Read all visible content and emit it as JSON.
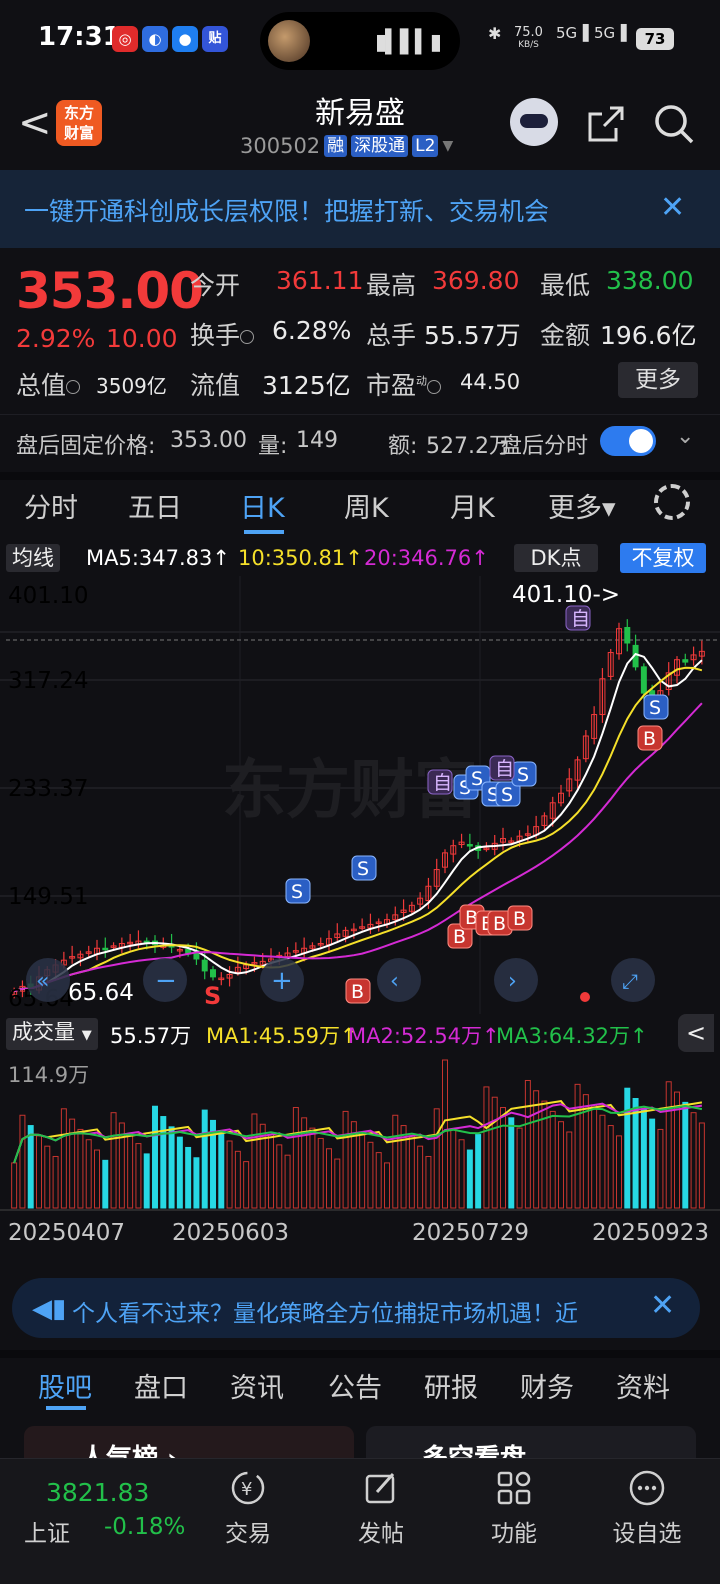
{
  "status_bar": {
    "time": "17:31",
    "net_speed": "75.0",
    "net_unit": "KB/S",
    "signal_1": "5G",
    "signal_2": "5G",
    "battery": "73"
  },
  "header": {
    "back": "<",
    "logo_line1": "东方",
    "logo_line2": "财富",
    "title": "新易盛",
    "code": "300502",
    "tags": [
      "融",
      "深股通",
      "L2"
    ]
  },
  "banner": {
    "text": "一键开通科创成长层权限！把握打新、交易机会",
    "close": "✕"
  },
  "quote": {
    "price": "353.00",
    "change_pct": "2.92%",
    "change": "10.00",
    "open_label": "今开",
    "open": "361.11",
    "high_label": "最高",
    "high": "369.80",
    "low_label": "最低",
    "low": "338.00",
    "turnover_label": "换手",
    "turnover": "6.28%",
    "volume_label": "总手",
    "volume": "55.57万",
    "amount_label": "金额",
    "amount": "196.6亿",
    "mktcap_label": "总值",
    "mktcap": "3509亿",
    "float_label": "流值",
    "float": "3125亿",
    "pe_label": "市盈",
    "pe_sup": "动",
    "pe": "44.50",
    "more": "更多"
  },
  "after_hours": {
    "price_label": "盘后固定价格:",
    "price": "353.00",
    "qty_label": "量:",
    "qty": "149",
    "amt_label": "额:",
    "amt": "527.2万",
    "ts_label": "盘后分时"
  },
  "period_tabs": [
    "分时",
    "五日",
    "日K",
    "周K",
    "月K",
    "更多▾"
  ],
  "active_period": "日K",
  "ma_legend": {
    "btn": "均线",
    "ma5": "MA5:347.83↑",
    "ma10": "10:350.81↑",
    "ma20": "20:346.76↑",
    "dk": "DK点",
    "adjust": "不复权"
  },
  "chart_labels": {
    "y_top": "401.10",
    "y2": "317.24",
    "y3": "233.37",
    "y4": "149.51",
    "y_bottom": "65.64",
    "max_marker": "401.10->",
    "min_marker": "65.64",
    "watermark": "东方财富"
  },
  "volume_legend": {
    "btn": "成交量",
    "vol": "55.57万",
    "ma1": "MA1:45.59万↑",
    "ma2": "MA2:52.54万↑",
    "ma3": "MA3:64.32万↑",
    "y_top": "114.9万",
    "collapse": "<"
  },
  "colors": {
    "up": "#f23a3a",
    "down": "#22c04a",
    "accent": "#4ea3f5",
    "ma5": "#ffffff",
    "ma10": "#f5e02a",
    "ma20": "#d42ad4",
    "vol_up": "#c7352f",
    "vol_down": "#27d8e4"
  },
  "chart_data": {
    "type": "candlestick",
    "x_ticks": [
      "20250407",
      "20250603",
      "20250729",
      "20250923"
    ],
    "ylim": [
      65.64,
      401.1
    ],
    "y_ticks": [
      "401.10",
      "317.24",
      "233.37",
      "149.51",
      "65.64"
    ],
    "high_marker": 401.1,
    "low_marker": 65.64,
    "approx_close": [
      68,
      72,
      70,
      80,
      86,
      90,
      94,
      97,
      99,
      101,
      104,
      103,
      106,
      108,
      109,
      110,
      108,
      107,
      106,
      105,
      103,
      100,
      95,
      85,
      80,
      79,
      82,
      88,
      90,
      92,
      93,
      95,
      98,
      100,
      102,
      104,
      106,
      108,
      112,
      116,
      119,
      120,
      122,
      124,
      126,
      128,
      132,
      136,
      140,
      146,
      156,
      170,
      184,
      190,
      193,
      190,
      186,
      188,
      192,
      196,
      194,
      198,
      200,
      206,
      215,
      226,
      234,
      246,
      262,
      282,
      300,
      330,
      352,
      372,
      360,
      340,
      318,
      305,
      320,
      335,
      346,
      344,
      350,
      353
    ],
    "volume_ylim": [
      0,
      114.9
    ]
  },
  "annotations": {
    "b": "B",
    "s": "S",
    "self": "自"
  },
  "promo": {
    "icon": "📢",
    "text": "个人看不过来？量化策略全方位捕捉市场机遇！近",
    "close": "✕"
  },
  "bottom_tabs": [
    "股吧",
    "盘口",
    "资讯",
    "公告",
    "研报",
    "财务",
    "资料"
  ],
  "active_bottom_tab": "股吧",
  "cards": [
    {
      "title": "人气榜 ›"
    },
    {
      "title": "多空看盘"
    }
  ],
  "nav": {
    "index_value": "3821.83",
    "index_name": "上证",
    "index_change": "-0.18%",
    "items": [
      "交易",
      "发帖",
      "功能",
      "设自选"
    ]
  }
}
